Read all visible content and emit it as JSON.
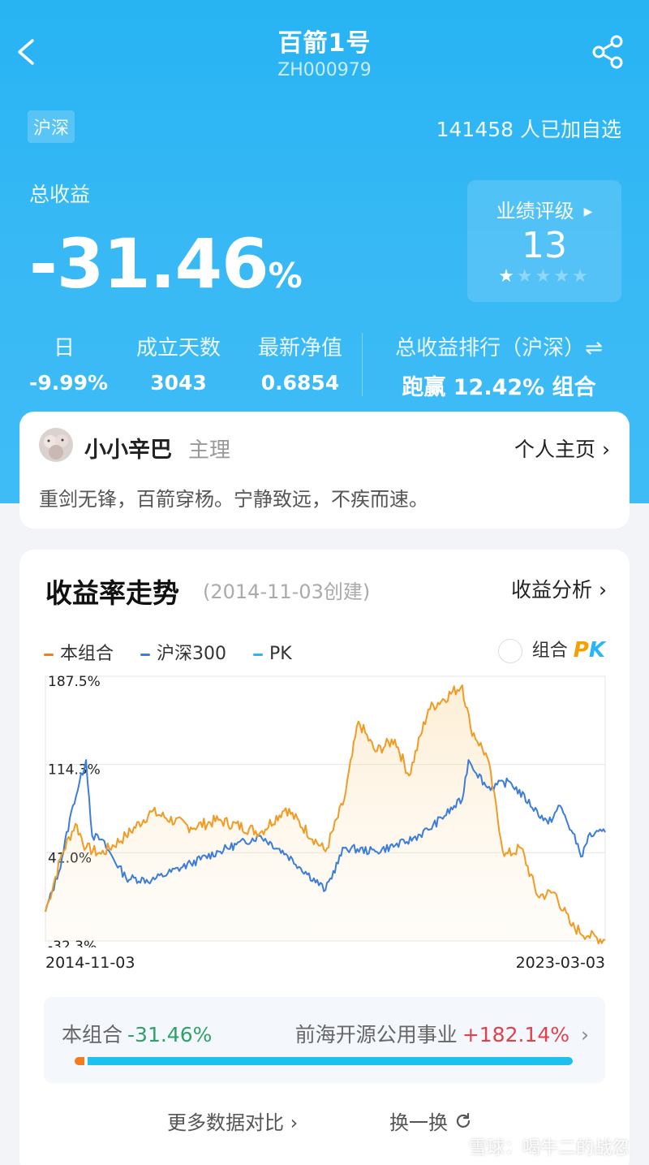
{
  "header": {
    "title": "百箭1号",
    "code": "ZH000979",
    "market_tag": "沪深",
    "followers": "141458 人已加自选"
  },
  "total_return": {
    "label": "总收益",
    "value": "-31.46",
    "unit": "%"
  },
  "rating": {
    "label": "业绩评级",
    "value": "13",
    "stars_filled": 1,
    "stars_total": 5
  },
  "stats": [
    {
      "label": "日",
      "value": "-9.99%"
    },
    {
      "label": "成立天数",
      "value": "3043"
    },
    {
      "label": "最新净值",
      "value": "0.6854"
    }
  ],
  "rank": {
    "label": "总收益排行（沪深）⇌",
    "value": "跑赢 12.42% 组合"
  },
  "manager": {
    "name": "小小辛巴",
    "role": "主理",
    "home_link": "个人主页 ›",
    "motto": "重剑无锋，百箭穿杨。宁静致远，不疾而速。"
  },
  "chart_section": {
    "title": "收益率走势",
    "created": "(2014-11-03创建)",
    "analysis_link": "收益分析 ›",
    "pk_label": "组合",
    "pk_mark_p": "P",
    "pk_mark_k": "K",
    "date_start": "2014-11-03",
    "date_end": "2023-03-03"
  },
  "chart_data": {
    "type": "line",
    "legend": [
      {
        "name": "本组合",
        "color": "#f19b24"
      },
      {
        "name": "沪深300",
        "color": "#3b7dd8"
      },
      {
        "name": "PK",
        "color": "#29b6f6"
      }
    ],
    "ytick_labels": [
      "187.5%",
      "114.3%",
      "41.0%",
      "-32.3%"
    ],
    "ylim": [
      -32.3,
      187.5
    ],
    "xlim": [
      "2014-11-03",
      "2023-03-03"
    ],
    "grid": true,
    "series": [
      {
        "name": "本组合",
        "color": "#f19b24",
        "x": [
          "2014-11-03",
          "2015-02-01",
          "2015-04-15",
          "2015-06-12",
          "2015-09-01",
          "2016-01-15",
          "2016-06-01",
          "2017-01-01",
          "2017-06-01",
          "2018-01-15",
          "2018-06-01",
          "2019-01-03",
          "2019-04-15",
          "2019-07-01",
          "2019-10-01",
          "2020-01-15",
          "2020-04-01",
          "2020-07-15",
          "2021-01-15",
          "2021-03-01",
          "2021-06-01",
          "2021-09-01",
          "2021-12-01",
          "2022-03-01",
          "2022-06-01",
          "2022-09-01",
          "2022-12-01",
          "2023-03-03"
        ],
        "values": [
          -8,
          40,
          65,
          45,
          40,
          55,
          75,
          62,
          68,
          58,
          78,
          42,
          85,
          150,
          125,
          135,
          105,
          160,
          180,
          145,
          120,
          38,
          45,
          5,
          8,
          -20,
          -28,
          -31.46
        ]
      },
      {
        "name": "沪深300",
        "color": "#3b7dd8",
        "x": [
          "2014-11-03",
          "2015-01-15",
          "2015-04-01",
          "2015-06-12",
          "2015-07-15",
          "2015-09-01",
          "2016-01-15",
          "2016-06-01",
          "2017-01-01",
          "2017-06-01",
          "2018-01-15",
          "2018-06-01",
          "2019-01-03",
          "2019-04-15",
          "2019-10-01",
          "2020-03-20",
          "2020-07-15",
          "2021-01-15",
          "2021-02-18",
          "2021-06-01",
          "2021-10-01",
          "2022-04-27",
          "2022-07-01",
          "2022-10-31",
          "2022-12-01",
          "2023-03-03"
        ],
        "values": [
          -8,
          25,
          80,
          118,
          55,
          52,
          20,
          18,
          32,
          42,
          55,
          40,
          10,
          45,
          42,
          50,
          60,
          85,
          118,
          95,
          100,
          65,
          80,
          38,
          55,
          58
        ]
      }
    ]
  },
  "comparison": {
    "left_label": "本组合",
    "left_value": "-31.46%",
    "right_label": "前海开源公用事业",
    "right_value": "+182.14%",
    "left_fraction": 0.02
  },
  "links": {
    "more_compare": "更多数据对比 ›",
    "switch": "换一换"
  },
  "watermark": "雪球：喝牛二的战忽"
}
